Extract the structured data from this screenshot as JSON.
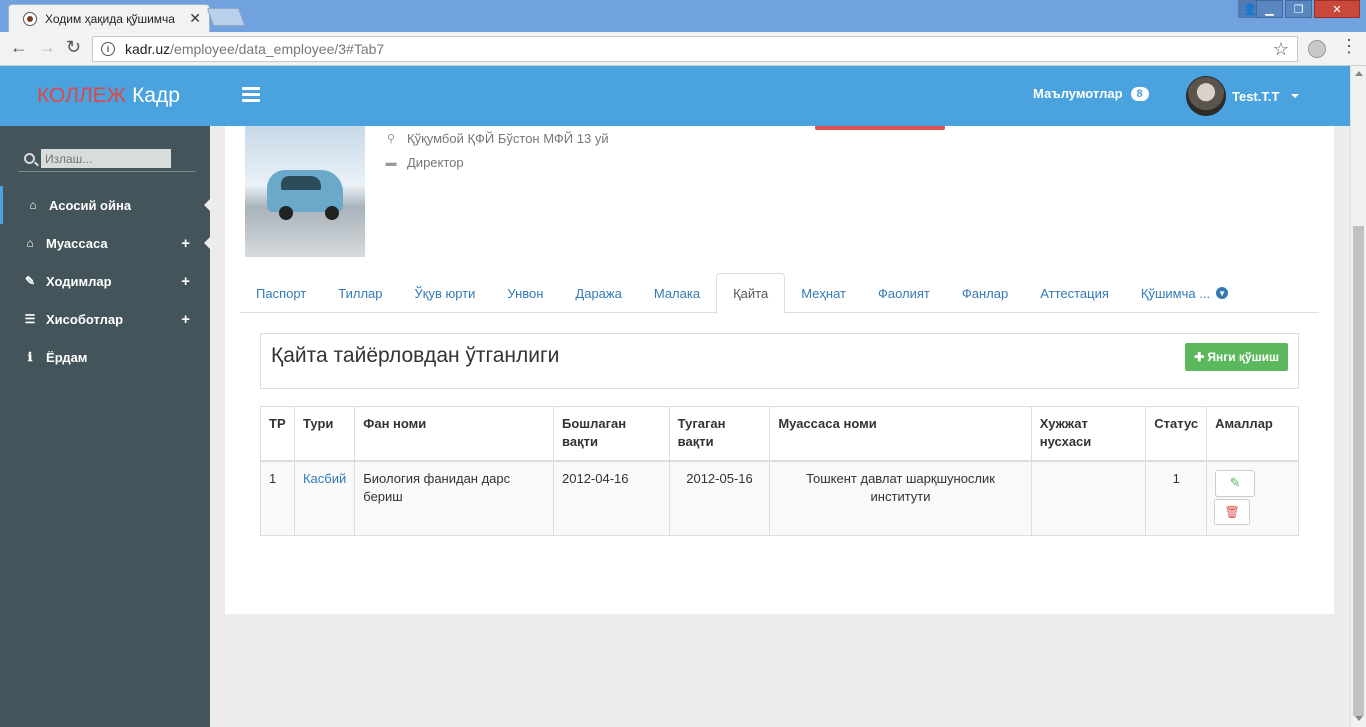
{
  "browser": {
    "tab_title": "Ходим ҳақида қўшимча",
    "tab_close": "✕",
    "url_domain": "kadr.uz",
    "url_path": "/employee/data_employee/3#Tab7"
  },
  "app": {
    "brand_part1": "КОЛЛЕЖ",
    "brand_part2": "Кадр",
    "search_placeholder": "Излаш...",
    "nav": [
      {
        "label": "Асосий ойна",
        "icon": "home-icon"
      },
      {
        "label": "Муассаса",
        "icon": "home-icon",
        "plus": "+"
      },
      {
        "label": "Ходимлар",
        "icon": "edit-icon",
        "plus": "+"
      },
      {
        "label": "Хисоботлар",
        "icon": "list-icon",
        "plus": "+"
      },
      {
        "label": "Ёрдам",
        "icon": "info-icon"
      }
    ],
    "notifications_label": "Маълумотлар",
    "notifications_count": "8",
    "user_name": "Test.T.T"
  },
  "profile": {
    "address": "Қўқумбой ҚФЙ Бўстон МФЙ 13 уй",
    "position": "Директор"
  },
  "tabs": [
    "Паспорт",
    "Тиллар",
    "Ўқув юрти",
    "Унвон",
    "Даража",
    "Малака",
    "Қайта",
    "Меҳнат",
    "Фаолият",
    "Фанлар",
    "Аттестация",
    "Қўшимча ..."
  ],
  "active_tab": "Қайта",
  "section": {
    "title": "Қайта тайёрловдан ўтганлиги",
    "add_button": "Янги қўшиш"
  },
  "table": {
    "headers": [
      "ТР",
      "Тури",
      "Фан номи",
      "Бошлаган вақти",
      "Тугаган вақти",
      "Муассаса номи",
      "Хужжат нусхаси",
      "Статус",
      "Амаллар"
    ],
    "rows": [
      {
        "tr": "1",
        "type": "Касбий",
        "subject": "Биология фанидан дарс бериш",
        "start": "2012-04-16",
        "end": "2012-05-16",
        "institution": "Тошкент давлат шарқшунослик институти",
        "document": "",
        "status": "1"
      }
    ]
  },
  "colors": {
    "header_blue": "#4aa3de",
    "sidebar": "#44545b",
    "brand_red": "#e04848",
    "add_green": "#5cb85c",
    "link_blue": "#337ab7"
  }
}
